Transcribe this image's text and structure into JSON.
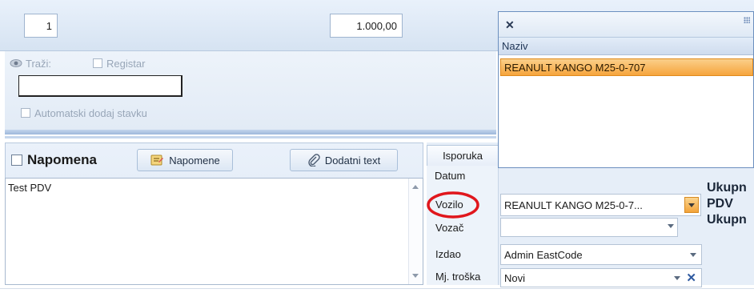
{
  "top": {
    "quantity": "1",
    "price": "1.000,00"
  },
  "search": {
    "trazi_label": "Traži:",
    "registar_label": "Registar",
    "search_value": "",
    "auto_add_label": "Automatski dodaj stavku"
  },
  "napomena": {
    "title": "Napomena",
    "napomene_button": "Napomene",
    "dodatni_text_button": "Dodatni text",
    "text": "Test PDV"
  },
  "isporuka": {
    "tab_label": "Isporuka",
    "datum_label": "Datum",
    "vozilo_label": "Vozilo",
    "vozilo_value": "REANULT KANGO M25-0-7...",
    "vozac_label": "Vozač",
    "vozac_value": "",
    "izdao_label": "Izdao",
    "izdao_value": "Admin EastCode",
    "mj_troska_label": "Mj. troška",
    "mj_troska_value": "Novi"
  },
  "popup": {
    "column_header": "Naziv",
    "selected_row": "REANULT KANGO M25-0-707"
  },
  "totals": {
    "line1": "Ukupn",
    "line2": "PDV",
    "line3": "Ukupn"
  },
  "colors": {
    "highlight": "#f6a53c",
    "annotation_circle": "#e0161c",
    "panel_blue": "#dbe6f4"
  }
}
